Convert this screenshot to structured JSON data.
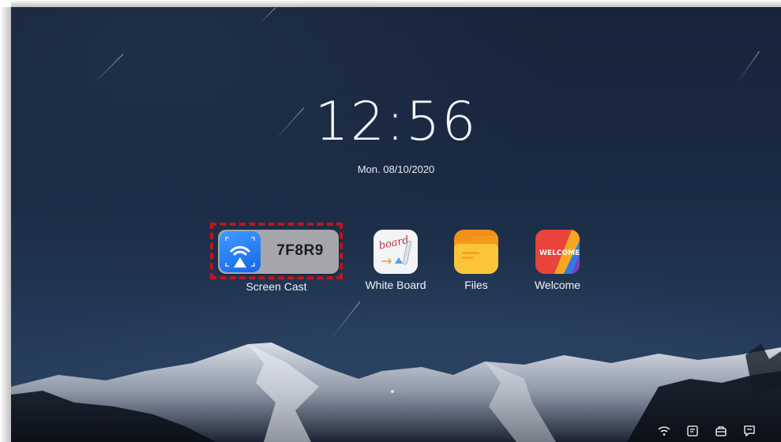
{
  "clock": {
    "time": "12:56",
    "date": "Mon. 08/10/2020"
  },
  "apps": [
    {
      "name": "Screen Cast",
      "code": "7F8R9",
      "icon": "screen-cast-icon"
    },
    {
      "name": "White Board",
      "icon": "whiteboard-icon",
      "icon_text": "board"
    },
    {
      "name": "Files",
      "icon": "folder-icon"
    },
    {
      "name": "Welcome",
      "icon": "welcome-icon",
      "icon_text": "WELCOME"
    }
  ],
  "tray": [
    "wifi-icon",
    "screenshot-icon",
    "toolbox-icon",
    "annotate-icon"
  ],
  "colors": {
    "highlight": "#c0141c",
    "cast_blue": "#1f7af0",
    "files_yellow": "#f7b52a",
    "welcome_red": "#e8433c"
  }
}
